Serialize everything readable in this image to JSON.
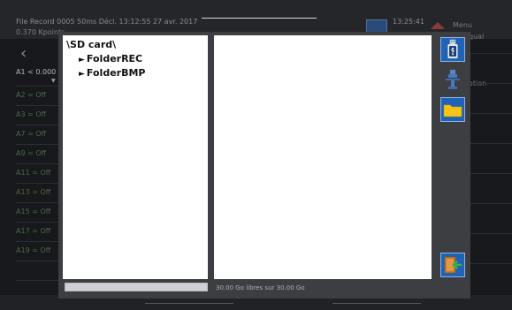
{
  "background": {
    "record_line": "File Record 0005  50ms  Décl. 13:12:55 27 avr. 2017",
    "points_line": "0.370 Kpoints",
    "clock": "13:25:41",
    "menu_label": "Menu",
    "menu_sub": "qual",
    "right_label": "ation",
    "channel_a1": "A1 < 0.000",
    "channels": [
      "A2  = Off",
      "A3  = Off",
      "A7  = Off",
      "A9  = Off",
      "A11 = Off",
      "A13 = Off",
      "A15 = Off",
      "A17 = Off",
      "A19 = Off",
      "",
      "",
      ""
    ]
  },
  "dialog": {
    "path": "\\SD card\\",
    "folders": [
      {
        "label": "FolderREC"
      },
      {
        "label": "FolderBMP"
      }
    ],
    "free_space": "30.00 Go libres sur 30.00 Go",
    "free_fraction": 1.0,
    "buttons": {
      "usb": {
        "icon": "usb-drive-icon"
      },
      "usb_transfer": {
        "icon": "usb-transfer-icon"
      },
      "folder": {
        "icon": "folder-icon"
      },
      "exit": {
        "icon": "exit-arrow-icon"
      }
    }
  },
  "colors": {
    "dialog_bg": "#3c3e42",
    "button_blue": "#1f63b8",
    "folder_yellow": "#f5c518",
    "exit_green": "#3cb043"
  }
}
